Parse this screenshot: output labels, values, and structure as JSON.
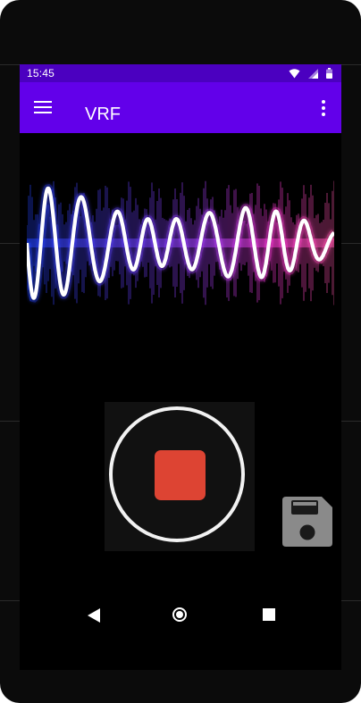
{
  "status_bar": {
    "time": "15:45",
    "icons": [
      "wifi-icon",
      "cell-signal-icon",
      "battery-icon"
    ]
  },
  "app_bar": {
    "title": "VRF",
    "menu_icon": "hamburger-menu-icon",
    "overflow_icon": "more-vert-icon"
  },
  "waveform_image": "audio-waveform-image",
  "recorder": {
    "record_button_icon": "stop-icon",
    "save_button_icon": "floppy-disk-save-icon"
  },
  "nav_bar": {
    "icons": [
      "back-icon",
      "home-icon",
      "recent-apps-icon"
    ]
  },
  "colors": {
    "status_bar": "#4b00c0",
    "app_bar": "#6200ea",
    "background": "#000000",
    "stop_button": "#dd4433",
    "save_icon": "#8a8a8a"
  }
}
